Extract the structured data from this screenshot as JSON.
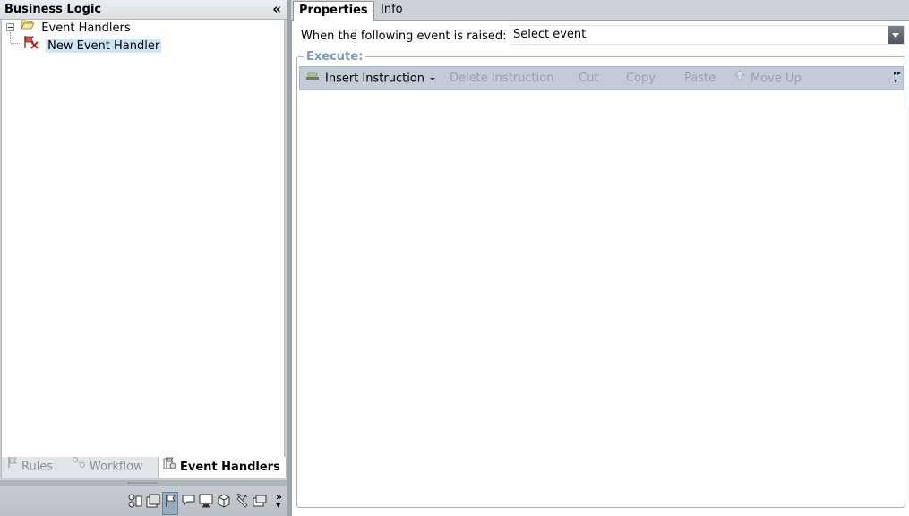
{
  "left_panel": {
    "title": "Business Logic",
    "collapse_glyph": "«",
    "tree": {
      "root": {
        "label": "Event Handlers",
        "icon": "folder-open-icon",
        "expanded": true
      },
      "children": [
        {
          "label": "New Event Handler",
          "icon": "event-handler-icon",
          "selected": true
        }
      ]
    },
    "bottom_tabs": [
      {
        "label": "Rules",
        "icon": "flag-icon",
        "active": false
      },
      {
        "label": "Workflow",
        "icon": "workflow-icon",
        "active": false
      },
      {
        "label": "Event Handlers",
        "icon": "event-handlers-icon",
        "active": true
      }
    ],
    "more_glyph": "»"
  },
  "right_panel": {
    "tabs": [
      {
        "label": "Properties",
        "active": true
      },
      {
        "label": "Info",
        "active": false
      }
    ],
    "event_label": "When the following event is raised:",
    "event_select_value": "Select event",
    "execute_legend": "Execute:",
    "toolbar": {
      "insert": "Insert Instruction",
      "delete": "Delete Instruction",
      "cut": "Cut",
      "copy": "Copy",
      "paste": "Paste",
      "move_up": "Move Up"
    }
  },
  "colors": {
    "accent_legend": "#7a9bbb",
    "selection": "#cfe5f7",
    "toolbar_bg": "#c2ccd6"
  }
}
